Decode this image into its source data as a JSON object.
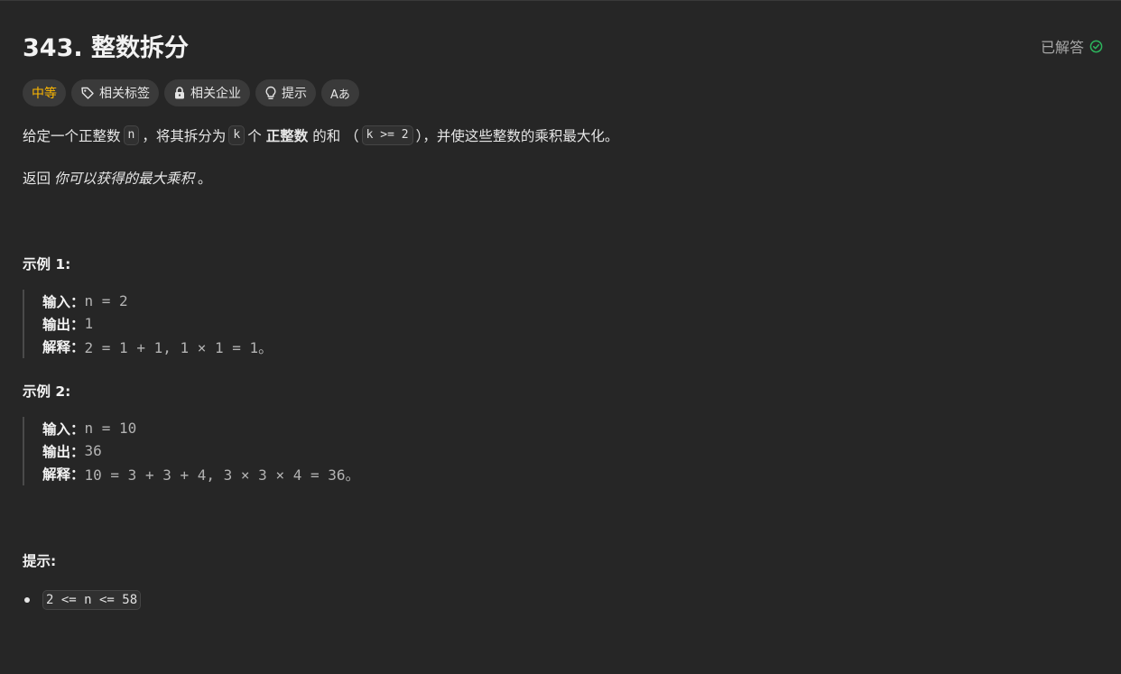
{
  "problem": {
    "title": "343. 整数拆分",
    "status": "已解答",
    "difficulty": "中等",
    "tags": [
      {
        "label": "相关标签",
        "icon": "tag-icon"
      },
      {
        "label": "相关企业",
        "icon": "lock-icon"
      },
      {
        "label": "提示",
        "icon": "lightbulb-icon"
      },
      {
        "label": "Aあ",
        "icon": "translate-icon"
      }
    ]
  },
  "description": {
    "p1": {
      "t1": "给定一个正整数",
      "c1": "n",
      "t2": "，将其拆分为",
      "c2": "k",
      "t3": "个",
      "b1": "正整数",
      "t4": "的和 （",
      "c3": "k >= 2",
      "t5": "），并使这些整数的乘积最大化。"
    },
    "p2": {
      "t1": "返回",
      "i1": "你可以获得的最大乘积",
      "t2": "。"
    }
  },
  "examples": [
    {
      "heading": "示例 1:",
      "input_label": "输入：",
      "input": "n = 2",
      "output_label": "输出：",
      "output": "1",
      "explain_label": "解释：",
      "explain": "2 = 1 + 1, 1 × 1 = 1。"
    },
    {
      "heading": "示例 2:",
      "input_label": "输入：",
      "input": "n = 10",
      "output_label": "输出：",
      "output": "36",
      "explain_label": "解释：",
      "explain": "10 = 3 + 3 + 4, 3 × 3 × 4 = 36。"
    }
  ],
  "constraints": {
    "heading": "提示:",
    "items": [
      "2 <= n <= 58"
    ]
  },
  "colors": {
    "background": "#262626",
    "difficulty_medium": "#ffb800",
    "solved_check": "#2db55d",
    "tag_bg": "#3a3a3a"
  }
}
